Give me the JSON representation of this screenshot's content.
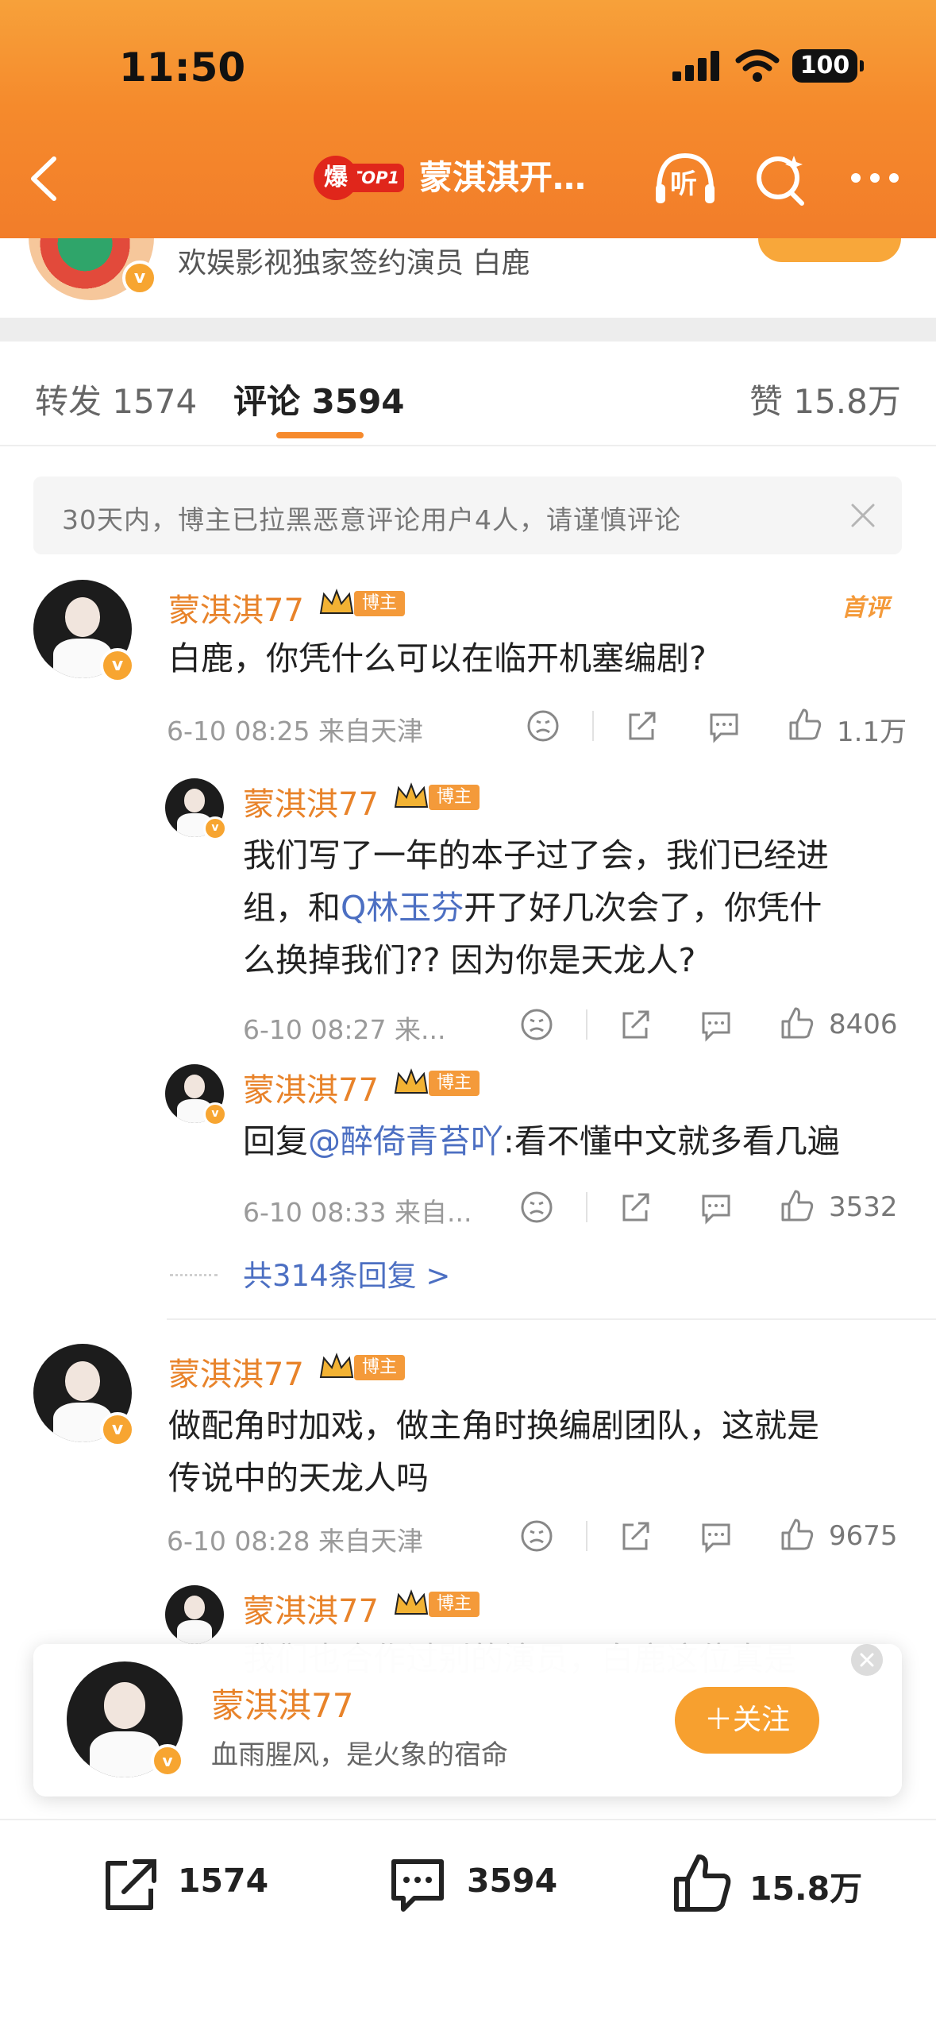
{
  "status_bar": {
    "time": "11:50",
    "battery": "100"
  },
  "nav": {
    "hot_badge_icon": "爆",
    "hot_badge_rank": "TOP1",
    "title": "蒙淇淇开…",
    "listen_label": "听"
  },
  "author_strip": {
    "description": "欢娱影视独家签约演员 白鹿"
  },
  "tabs": [
    {
      "label": "转发 1574"
    },
    {
      "label": "评论 3594"
    },
    {
      "label": "赞 15.8万"
    }
  ],
  "notice": {
    "text": "30天内，博主已拉黑恶意评论用户4人，请谨慎评论"
  },
  "comments": {
    "c1": {
      "user": "蒙淇淇77",
      "badge": "博主",
      "first_tag": "首评",
      "text": "白鹿，你凭什么可以在临开机塞编剧?",
      "meta": "6-10 08:25 来自天津",
      "likes": "1.1万",
      "replies": [
        {
          "user": "蒙淇淇77",
          "badge": "博主",
          "text_a": "我们写了一年的本子过了会，我们已经进",
          "text_b_pre": "组，和",
          "text_b_link": "Q林玉芬",
          "text_b_post": "开了好几次会了，你凭什",
          "text_c": "么换掉我们??  因为你是天龙人?",
          "meta": "6-10 08:27 来...",
          "likes": "8406"
        },
        {
          "user": "蒙淇淇77",
          "badge": "博主",
          "text_pre": "回复",
          "text_link": "@醉倚青苔吖",
          "text_post": ":看不懂中文就多看几遍",
          "meta": "6-10 08:33 来自...",
          "likes": "3532"
        }
      ],
      "more_replies": "共314条回复 >"
    },
    "c2": {
      "user": "蒙淇淇77",
      "badge": "博主",
      "text_a": "做配角时加戏，做主角时换编剧团队，这就是",
      "text_b": "传说中的天龙人吗",
      "meta": "6-10 08:28 来自天津",
      "likes": "9675",
      "reply": {
        "user": "蒙淇淇77",
        "badge": "博主",
        "text": "我们也合作过别的演员，白鹿这位真是"
      }
    }
  },
  "popup": {
    "name": "蒙淇淇77",
    "bio": "血雨腥风，是火象的宿命",
    "follow": "＋关注"
  },
  "bottom_bar": {
    "reposts": "1574",
    "comments": "3594",
    "likes": "15.8万"
  },
  "colors": {
    "accent": "#f68a2d",
    "username": "#e8832a",
    "link": "#4c6fc2"
  }
}
